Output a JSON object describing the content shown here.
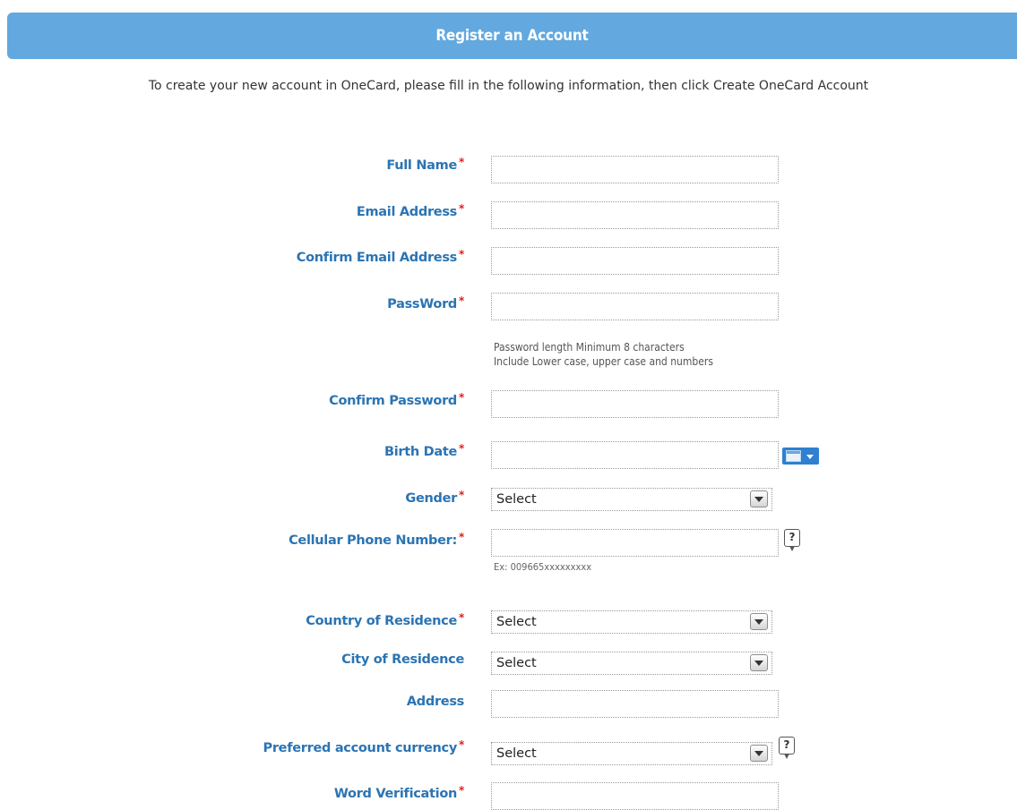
{
  "header": {
    "title": "Register an Account"
  },
  "intro": {
    "text": "To create your new account in OneCard, please fill in the following information, then click Create OneCard Account"
  },
  "required_mark": "*",
  "fields": {
    "full_name": {
      "label": "Full Name"
    },
    "email": {
      "label": "Email Address"
    },
    "confirm_email": {
      "label": "Confirm Email Address"
    },
    "password": {
      "label": "PassWord"
    },
    "password_hint_1": "Password length Minimum 8 characters",
    "password_hint_2": "Include Lower case, upper case and numbers",
    "confirm_password": {
      "label": "Confirm Password"
    },
    "birth_date": {
      "label": "Birth Date"
    },
    "gender": {
      "label": "Gender",
      "selected": "Select"
    },
    "cellular_phone": {
      "label": "Cellular Phone Number:",
      "hint": "Ex: 009665xxxxxxxxx"
    },
    "country": {
      "label": "Country of Residence",
      "selected": "Select"
    },
    "city": {
      "label": "City of Residence",
      "selected": "Select"
    },
    "address": {
      "label": "Address"
    },
    "currency": {
      "label": "Preferred account currency",
      "selected": "Select"
    },
    "word_verification": {
      "label": "Word Verification"
    }
  },
  "help_icon_glyph": "?",
  "icons": {
    "calendar": "calendar-icon",
    "help": "help-icon",
    "dropdown": "chevron-down-icon"
  },
  "colors": {
    "header_bg": "#63a8de",
    "label": "#2b74b3",
    "required": "#e02020"
  }
}
